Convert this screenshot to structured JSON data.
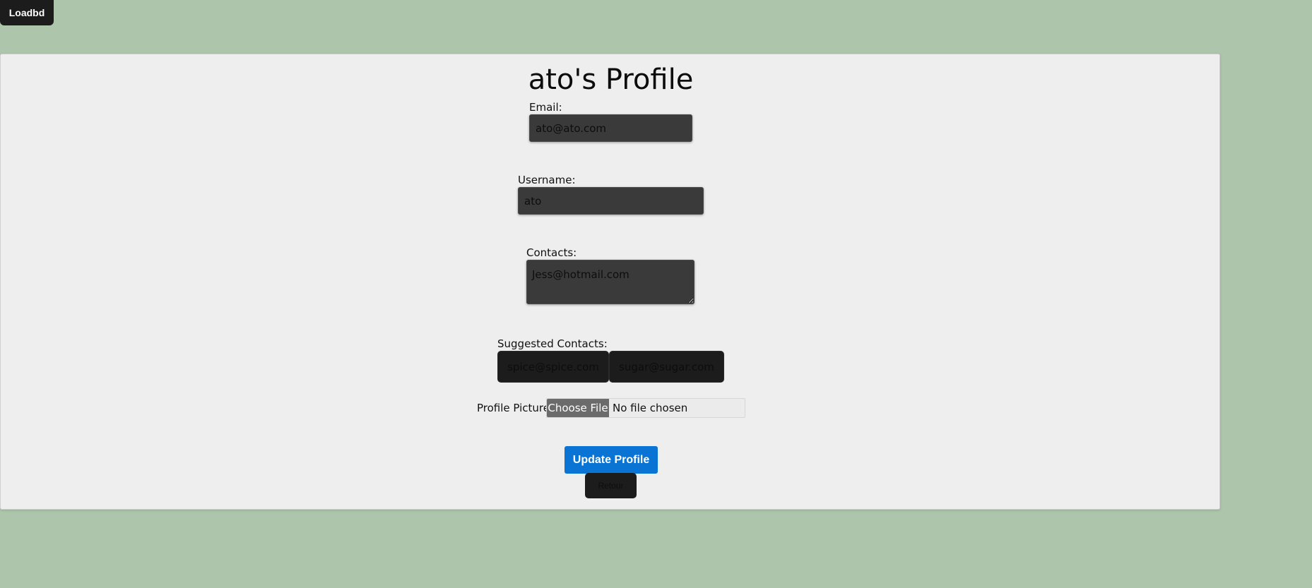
{
  "loadbd_label": "Loadbd",
  "title": "ato's Profile",
  "email": {
    "label": "Email:",
    "value": "ato@ato.com"
  },
  "username": {
    "label": "Username:",
    "value": "ato"
  },
  "contacts": {
    "label": "Contacts:",
    "value": "Jess@hotmail.com"
  },
  "suggested": {
    "label": "Suggested Contacts:",
    "items": [
      "spice@spice.com",
      "sugar@sugar.com"
    ]
  },
  "profile_picture": {
    "label": "Profile Picture:",
    "button_label": "Choose File",
    "status": "No file chosen"
  },
  "update_label": "Update Profile",
  "retour_label": "Retour",
  "colors": {
    "background": "#adc5ab",
    "card": "#eeeeee",
    "input_bg": "#3a3a3a",
    "dark_button": "#1c1c1c",
    "primary": "#0a74d4"
  }
}
